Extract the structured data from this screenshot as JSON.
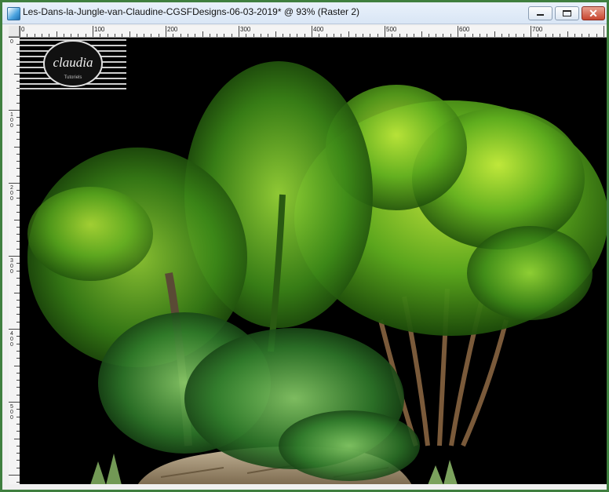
{
  "window": {
    "title": "Les-Dans-la-Jungle-van-Claudine-CGSFDesigns-06-03-2019* @  93% (Raster 2)"
  },
  "ruler": {
    "h_labels": [
      "0",
      "100",
      "200",
      "300",
      "400",
      "500",
      "600",
      "700"
    ],
    "v_labels": [
      "0",
      "100",
      "200",
      "300",
      "400",
      "500"
    ]
  },
  "canvas": {
    "watermark_text": "claudia",
    "watermark_subtext": "Tutoriels"
  },
  "icons": {
    "app": "psp-app-icon",
    "minimize": "minimize-icon",
    "maximize": "maximize-icon",
    "close": "close-icon"
  },
  "colors": {
    "frame": "#3f7f3f",
    "canvas_bg": "#000000",
    "close_button": "#c7452f"
  }
}
